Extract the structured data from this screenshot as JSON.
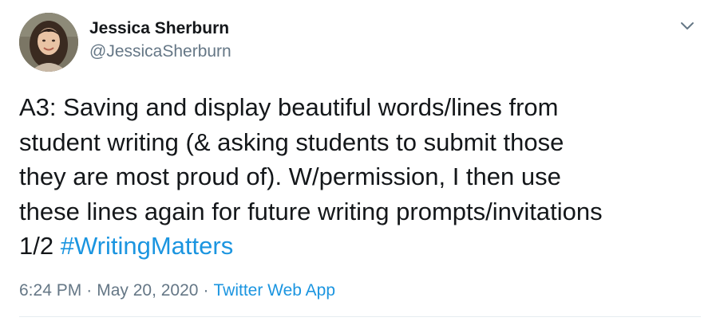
{
  "author": {
    "display_name": "Jessica Sherburn",
    "handle": "@JessicaSherburn",
    "avatar_icon": "profile-photo"
  },
  "tweet": {
    "lines": [
      "A3: Saving and display beautiful words/lines from",
      "student writing (& asking students to submit those",
      "they are most proud of). W/permission, I then use",
      "these lines again for future writing prompts/invitations"
    ],
    "last_line_prefix": "1/2 ",
    "hashtag": "#WritingMatters"
  },
  "meta": {
    "time": "6:24 PM",
    "separator": "·",
    "date": "May 20, 2020",
    "source": "Twitter Web App"
  },
  "menu": {
    "icon": "chevron-down-icon"
  },
  "colors": {
    "text": "#14171a",
    "secondary": "#657786",
    "link": "#1b95e0",
    "divider": "#e6ecf0"
  }
}
